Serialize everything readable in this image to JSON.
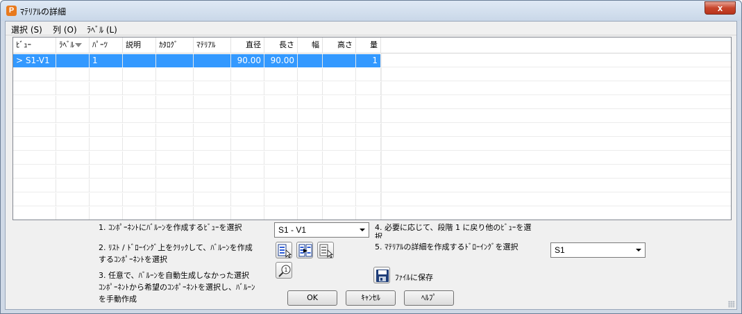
{
  "window": {
    "title": "ﾏﾃﾘｱﾙの詳細",
    "app_icon_letter": "P",
    "close_glyph": "x"
  },
  "menu": {
    "select": "選択 (S)",
    "column": "列 (O)",
    "label": "ﾗﾍﾞﾙ (L)"
  },
  "table": {
    "columns": [
      "ﾋﾞｭｰ",
      "ﾗﾍﾞﾙ",
      "ﾊﾟｰﾂ",
      "説明",
      "ｶﾀﾛｸﾞ",
      "ﾏﾃﾘｱﾙ",
      "直径",
      "長さ",
      "幅",
      "高さ",
      "量"
    ],
    "rows": [
      {
        "view": "> S1-V1",
        "label": "",
        "parts": "1",
        "description": "",
        "catalog": "",
        "material": "",
        "diameter": "90.00",
        "length": "90.00",
        "width": "",
        "height": "",
        "quantity": "1"
      }
    ]
  },
  "steps": {
    "step1": "1. ｺﾝﾎﾟｰﾈﾝﾄにﾊﾞﾙｰﾝを作成するﾋﾞｭｰを選択",
    "step2_line1": "2. ﾘｽﾄ / ﾄﾞﾛｰｲﾝｸﾞ上をｸﾘｯｸして、ﾊﾞﾙｰﾝを作成",
    "step2_line2": "するｺﾝﾎﾟｰﾈﾝﾄを選択",
    "step3_line1": "3. 任意で、ﾊﾞﾙｰﾝを自動生成しなかった選択",
    "step3_line2": "ｺﾝﾎﾟｰﾈﾝﾄから希望のｺﾝﾎﾟｰﾈﾝﾄを選択し、ﾊﾞﾙｰﾝ",
    "step3_line3": "を手動作成",
    "step4_line1": "4. 必要に応じて、段階 1 に戻り他のﾋﾞｭｰを選",
    "step4_line2": "択",
    "step5": "5. ﾏﾃﾘｱﾙの詳細を作成するﾄﾞﾛｰｲﾝｸﾞを選択"
  },
  "view_select": {
    "value": "S1 - V1"
  },
  "drawing_select": {
    "value": "S1"
  },
  "save": {
    "label": "ﾌｧｲﾙに保存"
  },
  "buttons": {
    "ok": "OK",
    "cancel": "ｷｬﾝｾﾙ",
    "help": "ﾍﾙﾌﾟ"
  }
}
